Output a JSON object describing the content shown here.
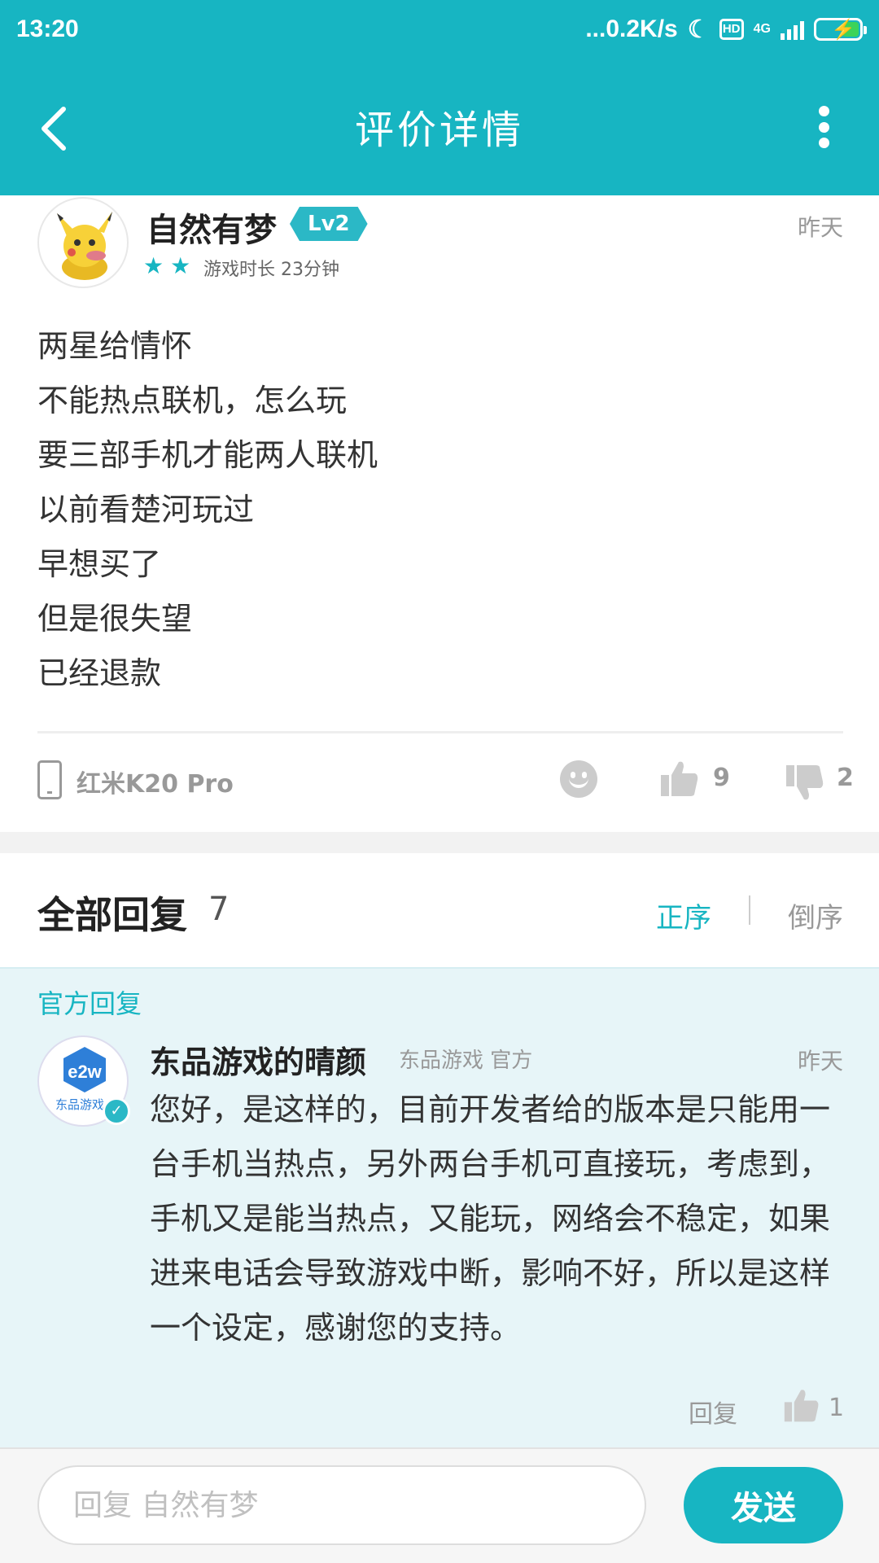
{
  "status_bar": {
    "time": "13:20",
    "net_speed": "...0.2K/s",
    "hd": "HD",
    "network": "4G"
  },
  "header": {
    "title": "评价详情"
  },
  "review": {
    "username": "自然有梦",
    "level": "Lv2",
    "star_rating": 2,
    "play_time": "游戏时长 23分钟",
    "time": "昨天",
    "lines": [
      "两星给情怀",
      "不能热点联机，怎么玩",
      "要三部手机才能两人联机",
      "以前看楚河玩过",
      "早想买了",
      "但是很失望",
      "已经退款"
    ],
    "device": "红米K20 Pro",
    "likes": "9",
    "dislikes": "2"
  },
  "replies": {
    "title": "全部回复",
    "count": "7",
    "sort_asc": "正序",
    "sort_desc": "倒序"
  },
  "official_reply": {
    "label": "官方回复",
    "name": "东品游戏的晴颜",
    "sub": "东品游戏 官方",
    "time": "昨天",
    "text": "您好，是这样的，目前开发者给的版本是只能用一台手机当热点，另外两台手机可直接玩，考虑到，手机又是能当热点，又能玩，网络会不稳定，如果进来电话会导致游戏中断，影响不好，所以是这样一个设定，感谢您的支持。",
    "reply_label": "回复",
    "likes": "1",
    "avatar_logo": "e2w",
    "avatar_caption": "东品游戏"
  },
  "input_bar": {
    "placeholder": "回复 自然有梦",
    "send_label": "发送"
  },
  "colors": {
    "accent": "#17b5c2",
    "official_bg": "#e7f5f8"
  }
}
